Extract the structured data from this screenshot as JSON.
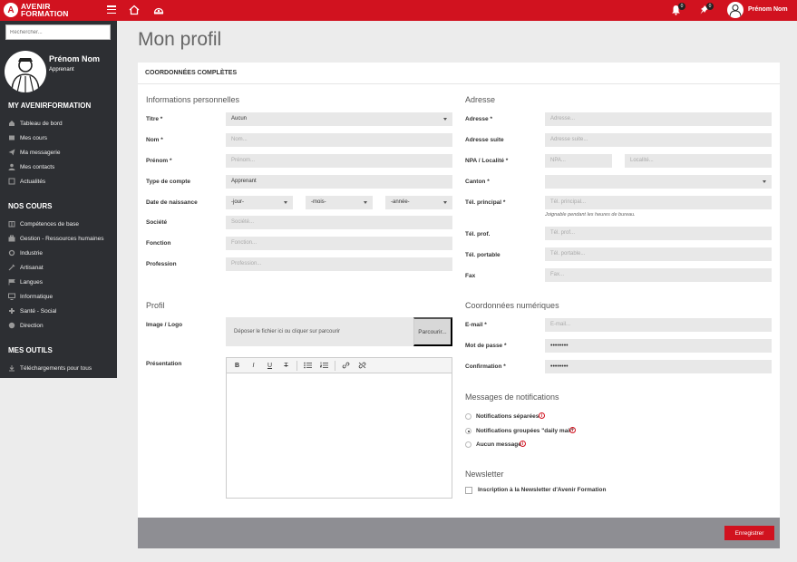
{
  "topbar": {
    "logo_mark": "A",
    "logo_line1": "AVENIR",
    "logo_line2": "FORMATION",
    "notifications_count": "0",
    "pins_count": "0",
    "username": "Prénom Nom"
  },
  "sidebar": {
    "search_placeholder": "Rechercher...",
    "user_name": "Prénom Nom",
    "user_role": "Apprenant",
    "sections": [
      {
        "title": "MY AVENIRFORMATION",
        "items": [
          {
            "label": "Tableau de bord",
            "icon": "dashboard-icon"
          },
          {
            "label": "Mes cours",
            "icon": "courses-icon"
          },
          {
            "label": "Ma messagerie",
            "icon": "send-icon"
          },
          {
            "label": "Mes contacts",
            "icon": "contacts-icon"
          },
          {
            "label": "Actualités",
            "icon": "news-icon"
          }
        ]
      },
      {
        "title": "NOS COURS",
        "items": [
          {
            "label": "Compétences de base",
            "icon": "book-icon"
          },
          {
            "label": "Gestion - Ressources humaines",
            "icon": "briefcase-icon"
          },
          {
            "label": "Industrie",
            "icon": "gears-icon"
          },
          {
            "label": "Artisanat",
            "icon": "tools-icon"
          },
          {
            "label": "Langues",
            "icon": "flag-icon"
          },
          {
            "label": "Informatique",
            "icon": "desktop-icon"
          },
          {
            "label": "Santé - Social",
            "icon": "health-icon"
          },
          {
            "label": "Direction",
            "icon": "compass-icon"
          }
        ]
      },
      {
        "title": "MES OUTILS",
        "items": [
          {
            "label": "Téléchargements pour tous",
            "icon": "download-icon"
          }
        ]
      }
    ]
  },
  "page": {
    "title": "Mon profil",
    "card_header": "COORDONNÉES COMPLÈTES",
    "save_label": "Enregistrer"
  },
  "personal": {
    "title": "Informations personnelles",
    "titre_label": "Titre *",
    "titre_value": "Aucun",
    "nom_label": "Nom *",
    "nom_placeholder": "Nom...",
    "prenom_label": "Prénom *",
    "prenom_placeholder": "Prénom...",
    "type_label": "Type de compte",
    "type_value": "Apprenant",
    "dob_label": "Date de naissance",
    "dob_day": "-jour-",
    "dob_month": "-mois-",
    "dob_year": "-année-",
    "societe_label": "Société",
    "societe_placeholder": "Société...",
    "fonction_label": "Fonction",
    "fonction_placeholder": "Fonction...",
    "profession_label": "Profession",
    "profession_placeholder": "Profession..."
  },
  "profil": {
    "title": "Profil",
    "image_label": "Image / Logo",
    "dropzone_text": "Déposer le fichier ici ou cliquer sur parcourir",
    "browse_label": "Parcourir...",
    "presentation_label": "Présentation"
  },
  "address": {
    "title": "Adresse",
    "adresse_label": "Adresse *",
    "adresse_placeholder": "Adresse...",
    "suite_label": "Adresse suite",
    "suite_placeholder": "Adresse suite...",
    "npa_label": "NPA / Localité *",
    "npa_placeholder": "NPA...",
    "localite_placeholder": "Localité...",
    "canton_label": "Canton *",
    "tel_label": "Tél. principal *",
    "tel_placeholder": "Tél. principal...",
    "tel_help": "Joignable pendant les heures de bureau.",
    "telprof_label": "Tél. prof.",
    "telprof_placeholder": "Tél. prof...",
    "telport_label": "Tél. portable",
    "telport_placeholder": "Tél. portable...",
    "fax_label": "Fax",
    "fax_placeholder": "Fax..."
  },
  "digital": {
    "title": "Coordonnées numériques",
    "email_label": "E-mail *",
    "email_placeholder": "E-mail...",
    "password_label": "Mot de passe *",
    "password_value": "••••••••",
    "confirm_label": "Confirmation *",
    "confirm_value": "••••••••"
  },
  "notifications": {
    "title": "Messages de notifications",
    "opt1": "Notifications séparées",
    "opt2": "Notifications groupées \"daily mail\"",
    "opt3": "Aucun message",
    "selected": 2
  },
  "newsletter": {
    "title": "Newsletter",
    "label": "Inscription à la Newsletter d'Avenir Formation"
  }
}
